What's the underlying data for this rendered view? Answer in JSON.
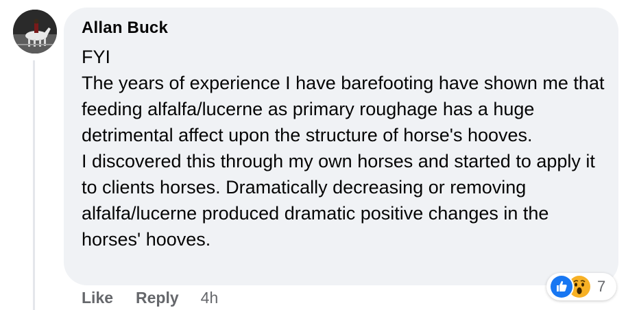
{
  "comment": {
    "author": "Allan Buck",
    "lines": [
      "FYI",
      "The years of experience I have barefooting have shown me that feeding alfalfa/lucerne as primary roughage has a huge detrimental affect upon the structure of horse's hooves.",
      "I discovered this through my own horses and started to apply it to clients horses. Dramatically decreasing or removing alfalfa/lucerne produced dramatic positive changes in the horses' hooves."
    ],
    "actions": {
      "like_label": "Like",
      "reply_label": "Reply",
      "timestamp": "4h"
    },
    "reactions": {
      "icons": [
        "like-icon",
        "wow-icon"
      ],
      "count": "7"
    }
  },
  "colors": {
    "bubble": "#f0f2f5",
    "text": "#050505",
    "secondary": "#65676b",
    "like_blue": "#1877f2",
    "wow_yellow": "#f7b125"
  }
}
